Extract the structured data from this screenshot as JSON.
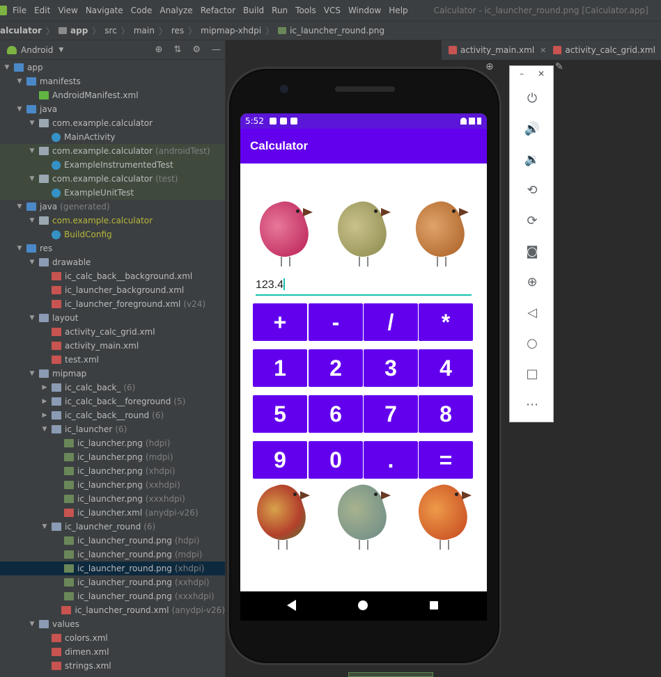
{
  "menu": {
    "items": [
      "File",
      "Edit",
      "View",
      "Navigate",
      "Code",
      "Analyze",
      "Refactor",
      "Build",
      "Run",
      "Tools",
      "VCS",
      "Window",
      "Help"
    ],
    "window_title": "Calculator - ic_launcher_round.png [Calculator.app]"
  },
  "breadcrumb": [
    "alculator",
    "app",
    "src",
    "main",
    "res",
    "mipmap-xhdpi",
    "ic_launcher_round.png"
  ],
  "project_panel": {
    "view_selector": "Android",
    "tree": [
      {
        "label": "app",
        "indent": 0,
        "expanded": true,
        "icon": "folder-icon"
      },
      {
        "label": "manifests",
        "indent": 1,
        "expanded": true,
        "icon": "folder-icon"
      },
      {
        "label": "AndroidManifest.xml",
        "indent": 2,
        "icon": "manifest-icon"
      },
      {
        "label": "java",
        "indent": 1,
        "expanded": true,
        "icon": "folder-icon"
      },
      {
        "label": "com.example.calculator",
        "indent": 2,
        "expanded": true,
        "icon": "package-icon"
      },
      {
        "label": "MainActivity",
        "indent": 3,
        "icon": "class-icon"
      },
      {
        "label": "com.example.calculator",
        "suffix": "(androidTest)",
        "indent": 2,
        "expanded": true,
        "icon": "package-icon",
        "test": true
      },
      {
        "label": "ExampleInstrumentedTest",
        "indent": 3,
        "icon": "class-icon",
        "test": true
      },
      {
        "label": "com.example.calculator",
        "suffix": "(test)",
        "indent": 2,
        "expanded": true,
        "icon": "package-icon",
        "test": true
      },
      {
        "label": "ExampleUnitTest",
        "indent": 3,
        "icon": "class-icon",
        "test": true
      },
      {
        "label": "java",
        "suffix": "(generated)",
        "indent": 1,
        "expanded": true,
        "icon": "folder-icon"
      },
      {
        "label": "com.example.calculator",
        "indent": 2,
        "expanded": true,
        "icon": "package-icon",
        "generated": true
      },
      {
        "label": "BuildConfig",
        "indent": 3,
        "icon": "class-icon",
        "generated": true
      },
      {
        "label": "res",
        "indent": 1,
        "expanded": true,
        "icon": "folder-icon"
      },
      {
        "label": "drawable",
        "indent": 2,
        "expanded": true,
        "icon": "folder-icon"
      },
      {
        "label": "ic_calc_back__background.xml",
        "indent": 3,
        "icon": "xml-icon"
      },
      {
        "label": "ic_launcher_background.xml",
        "indent": 3,
        "icon": "xml-icon"
      },
      {
        "label": "ic_launcher_foreground.xml",
        "suffix": "(v24)",
        "indent": 3,
        "icon": "xml-icon"
      },
      {
        "label": "layout",
        "indent": 2,
        "expanded": true,
        "icon": "folder-icon"
      },
      {
        "label": "activity_calc_grid.xml",
        "indent": 3,
        "icon": "xml-icon"
      },
      {
        "label": "activity_main.xml",
        "indent": 3,
        "icon": "xml-icon"
      },
      {
        "label": "test.xml",
        "indent": 3,
        "icon": "xml-icon"
      },
      {
        "label": "mipmap",
        "indent": 2,
        "expanded": true,
        "icon": "folder-icon"
      },
      {
        "label": "ic_calc_back_",
        "suffix": "(6)",
        "indent": 3,
        "expanded": false,
        "icon": "folder-icon"
      },
      {
        "label": "ic_calc_back__foreground",
        "suffix": "(5)",
        "indent": 3,
        "expanded": false,
        "icon": "folder-icon"
      },
      {
        "label": "ic_calc_back__round",
        "suffix": "(6)",
        "indent": 3,
        "expanded": false,
        "icon": "folder-icon"
      },
      {
        "label": "ic_launcher",
        "suffix": "(6)",
        "indent": 3,
        "expanded": true,
        "icon": "folder-icon"
      },
      {
        "label": "ic_launcher.png",
        "suffix": "(hdpi)",
        "indent": 4,
        "icon": "image-icon"
      },
      {
        "label": "ic_launcher.png",
        "suffix": "(mdpi)",
        "indent": 4,
        "icon": "image-icon"
      },
      {
        "label": "ic_launcher.png",
        "suffix": "(xhdpi)",
        "indent": 4,
        "icon": "image-icon"
      },
      {
        "label": "ic_launcher.png",
        "suffix": "(xxhdpi)",
        "indent": 4,
        "icon": "image-icon"
      },
      {
        "label": "ic_launcher.png",
        "suffix": "(xxxhdpi)",
        "indent": 4,
        "icon": "image-icon"
      },
      {
        "label": "ic_launcher.xml",
        "suffix": "(anydpi-v26)",
        "indent": 4,
        "icon": "xml-icon"
      },
      {
        "label": "ic_launcher_round",
        "suffix": "(6)",
        "indent": 3,
        "expanded": true,
        "icon": "folder-icon"
      },
      {
        "label": "ic_launcher_round.png",
        "suffix": "(hdpi)",
        "indent": 4,
        "icon": "image-icon"
      },
      {
        "label": "ic_launcher_round.png",
        "suffix": "(mdpi)",
        "indent": 4,
        "icon": "image-icon"
      },
      {
        "label": "ic_launcher_round.png",
        "suffix": "(xhdpi)",
        "indent": 4,
        "icon": "image-icon",
        "selected": true
      },
      {
        "label": "ic_launcher_round.png",
        "suffix": "(xxhdpi)",
        "indent": 4,
        "icon": "image-icon"
      },
      {
        "label": "ic_launcher_round.png",
        "suffix": "(xxxhdpi)",
        "indent": 4,
        "icon": "image-icon"
      },
      {
        "label": "ic_launcher_round.xml",
        "suffix": "(anydpi-v26)",
        "indent": 4,
        "icon": "xml-icon"
      },
      {
        "label": "values",
        "indent": 2,
        "expanded": true,
        "icon": "folder-icon"
      },
      {
        "label": "colors.xml",
        "indent": 3,
        "icon": "xml-icon"
      },
      {
        "label": "dimen.xml",
        "indent": 3,
        "icon": "xml-icon"
      },
      {
        "label": "strings.xml",
        "indent": 3,
        "icon": "xml-icon"
      }
    ]
  },
  "editor_tabs": [
    {
      "label": "activity_main.xml"
    },
    {
      "label": "activity_calc_grid.xml"
    }
  ],
  "device": {
    "status_time": "5:52",
    "app_title": "Calculator",
    "display_value": "123.4",
    "keys": [
      [
        "+",
        "-",
        "/",
        "*"
      ],
      [
        "1",
        "2",
        "3",
        "4"
      ],
      [
        "5",
        "6",
        "7",
        "8"
      ],
      [
        "9",
        "0",
        ".",
        "="
      ]
    ]
  },
  "emulator_toolbar": {
    "buttons": [
      "power-icon",
      "volume-up-icon",
      "volume-down-icon",
      "rotate-left-icon",
      "rotate-right-icon",
      "camera-icon",
      "zoom-icon",
      "back-icon",
      "home-icon",
      "overview-icon",
      "more-icon"
    ]
  },
  "colors": {
    "accent": "#6200ee",
    "status_bar": "#5b16d9",
    "cursor": "#14c0b0",
    "selection": "#0d293e"
  }
}
